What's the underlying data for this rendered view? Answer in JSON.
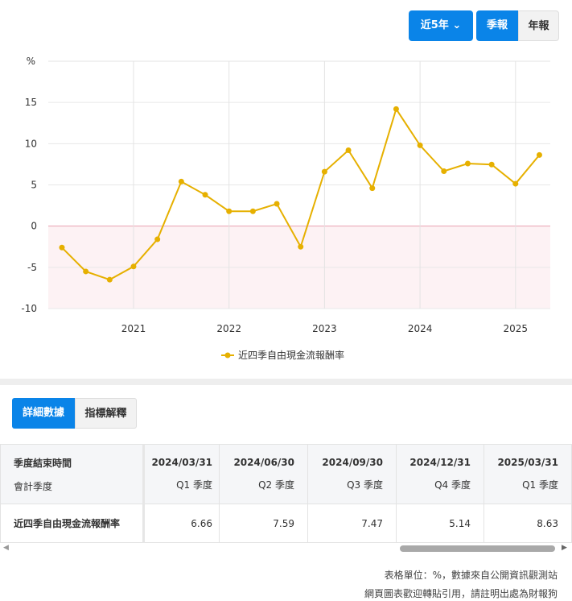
{
  "controls": {
    "range_label": "近5年",
    "quarterly_label": "季報",
    "annual_label": "年報"
  },
  "tabs": {
    "detail": "詳細數據",
    "explain": "指標解釋"
  },
  "chart_data": {
    "type": "line",
    "ylabel": "%",
    "ylim": [
      -10,
      20
    ],
    "yticks": [
      -10,
      -5,
      0,
      5,
      10,
      15
    ],
    "xticks": [
      "2021",
      "2022",
      "2023",
      "2024",
      "2025"
    ],
    "series": [
      {
        "name": "近四季自由現金流報酬率",
        "color": "#e6b000",
        "x": [
          "2020/03/31",
          "2020/06/30",
          "2020/09/30",
          "2020/12/31",
          "2021/03/31",
          "2021/06/30",
          "2021/09/30",
          "2021/12/31",
          "2022/03/31",
          "2022/06/30",
          "2022/09/30",
          "2022/12/31",
          "2023/03/31",
          "2023/06/30",
          "2023/09/30",
          "2023/12/31",
          "2024/03/31",
          "2024/06/30",
          "2024/09/30",
          "2024/12/31",
          "2025/03/31"
        ],
        "values": [
          -2.6,
          -5.5,
          -6.5,
          -4.9,
          -1.6,
          5.4,
          3.8,
          1.8,
          1.8,
          2.7,
          -2.5,
          6.6,
          9.2,
          4.6,
          14.2,
          9.8,
          6.66,
          7.59,
          7.47,
          5.14,
          8.63
        ]
      }
    ],
    "legend": "bottom-center"
  },
  "table": {
    "header_label": "季度結束時間",
    "subheader_label": "會計季度",
    "columns": [
      {
        "date": "2024/03/31",
        "q": "Q1 季度"
      },
      {
        "date": "2024/06/30",
        "q": "Q2 季度"
      },
      {
        "date": "2024/09/30",
        "q": "Q3 季度"
      },
      {
        "date": "2024/12/31",
        "q": "Q4 季度"
      },
      {
        "date": "2025/03/31",
        "q": "Q1 季度"
      }
    ],
    "row_label": "近四季自由現金流報酬率",
    "values": [
      "6.66",
      "7.59",
      "7.47",
      "5.14",
      "8.63"
    ]
  },
  "footer": {
    "line1": "表格單位：%，數據來自公開資訊觀測站",
    "line2": "網頁圖表歡迎轉貼引用，請註明出處為財報狗"
  }
}
